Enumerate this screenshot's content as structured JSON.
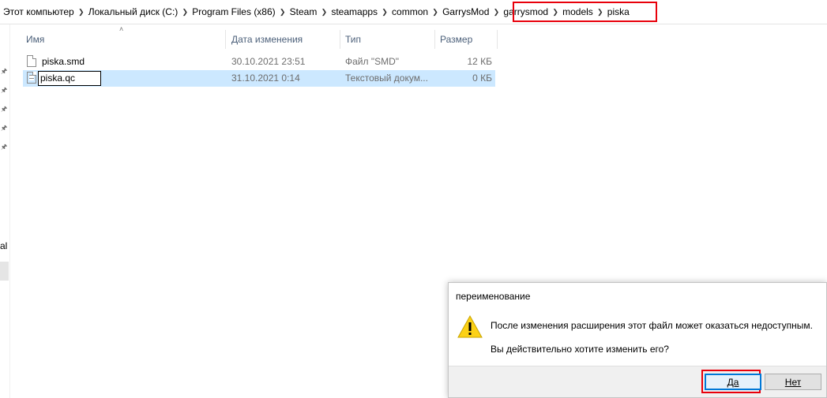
{
  "breadcrumb": [
    "Этот компьютер",
    "Локальный диск (C:)",
    "Program Files (x86)",
    "Steam",
    "steamapps",
    "common",
    "GarrysMod",
    "garrysmod",
    "models",
    "piska"
  ],
  "columns": {
    "name": "Имя",
    "date": "Дата изменения",
    "type": "Тип",
    "size": "Размер"
  },
  "files": [
    {
      "name": "piska.smd",
      "date": "30.10.2021 23:51",
      "type": "Файл \"SMD\"",
      "size": "12 КБ",
      "icon": "file-icon"
    },
    {
      "name": "piska.qc",
      "date": "31.10.2021 0:14",
      "type": "Текстовый докум...",
      "size": "0 КБ",
      "icon": "text-file-icon"
    }
  ],
  "left_pane_letter": "al",
  "dialog": {
    "title": "переименование",
    "message1": "После изменения расширения этот файл может оказаться недоступным.",
    "message2": "Вы действительно хотите изменить его?",
    "yes_label": "Да",
    "no_label": "Нет",
    "icon": "warning-icon"
  },
  "colors": {
    "highlight": "#e8000b",
    "selection": "#cce8ff",
    "header_text": "#4c607a"
  }
}
